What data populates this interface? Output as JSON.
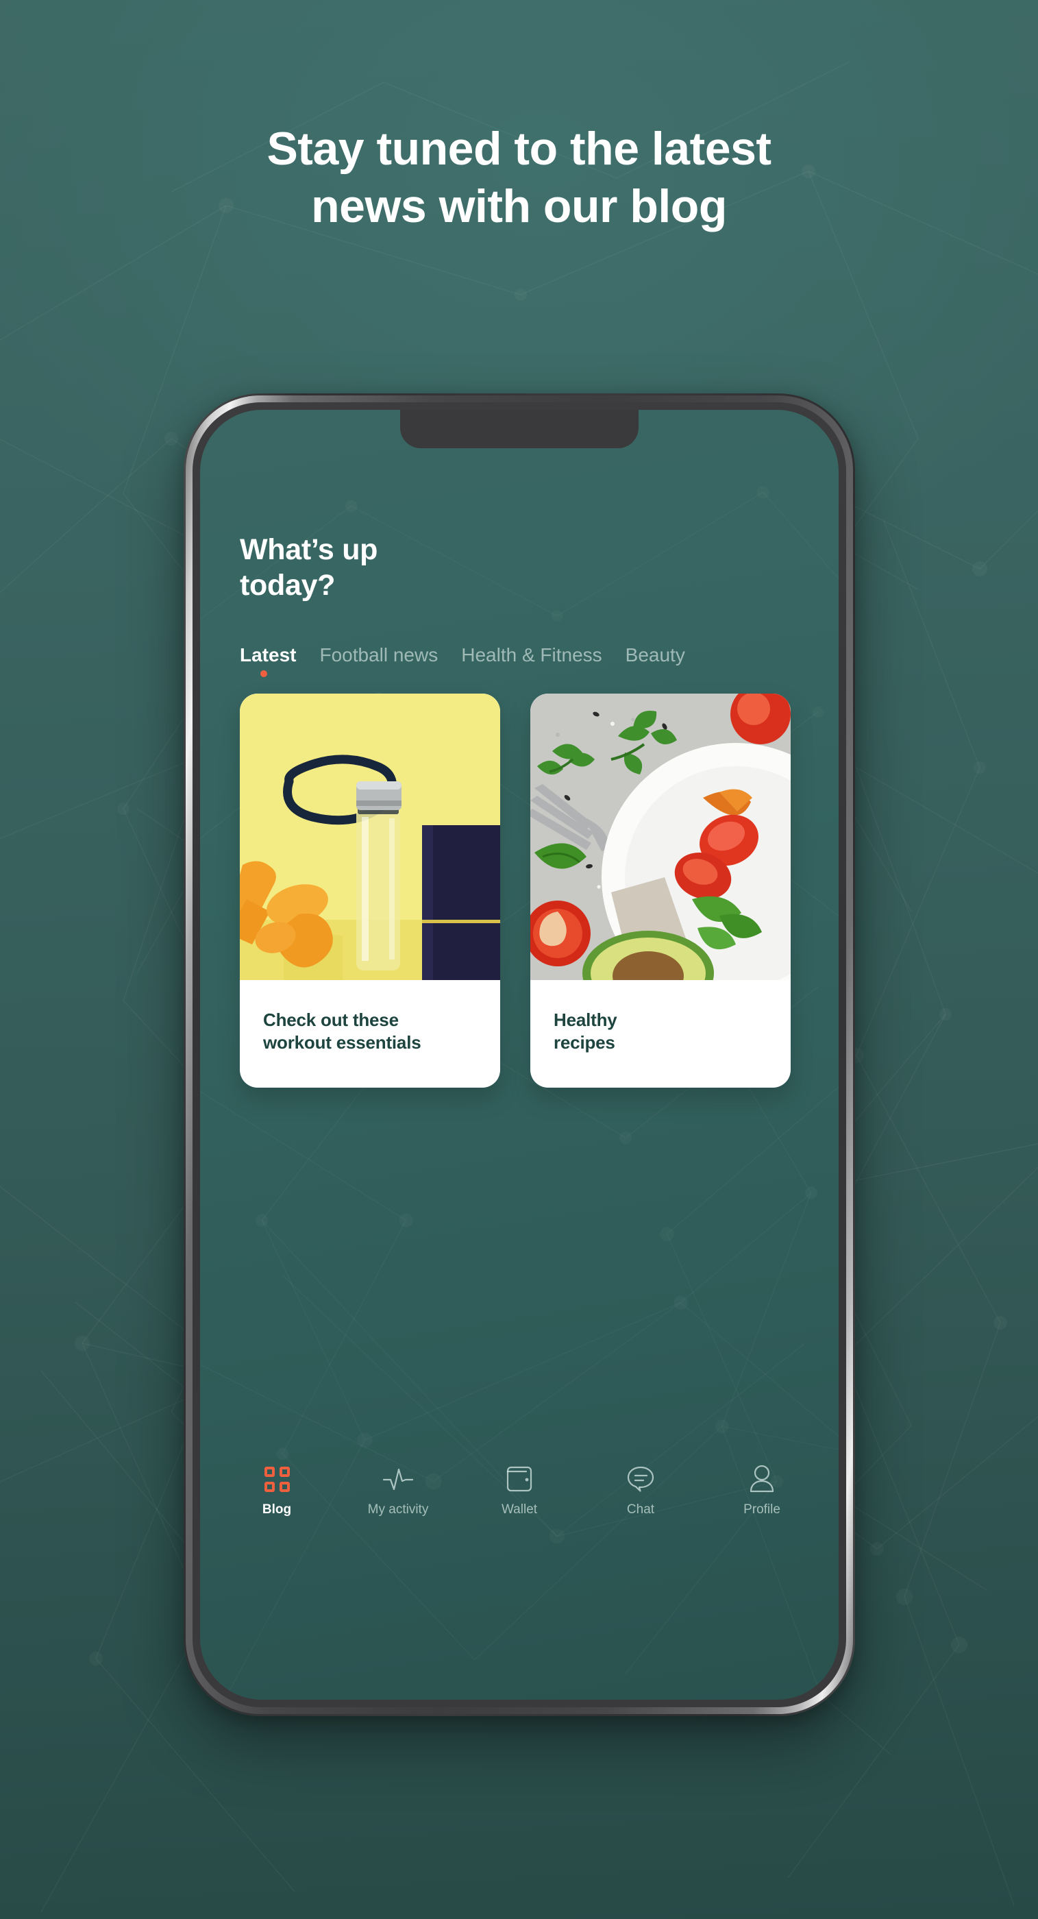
{
  "colors": {
    "bg_top": "#3e6965",
    "bg_bottom": "#284a47",
    "screen_bg": "#356460",
    "accent_orange": "#f0603f",
    "card_title": "#1d443f",
    "white": "#ffffff",
    "frame_dark": "#3a3a3c",
    "frame_silver": "#efefef"
  },
  "headline": {
    "text": "Stay tuned to the latest\nnews with our blog"
  },
  "phone": {
    "notch_label": "notch",
    "app": {
      "title": "What’s up\ntoday?",
      "tabs": [
        {
          "label": "Latest",
          "active": true
        },
        {
          "label": "Football news",
          "active": false
        },
        {
          "label": "Health & Fitness",
          "active": false
        },
        {
          "label": "Beauty",
          "active": false
        }
      ],
      "cards": [
        {
          "title": "Check out these\nworkout essentials",
          "image_alt": "water-bottle-dumbbells-towel-on-yellow-background",
          "image_bg": "#f2e97e"
        },
        {
          "title": "Healthy\nrecipes",
          "image_alt": "salad-plate-with-tomatoes-spinach-avocado-on-grey-stone",
          "image_bg": "#c9c9c6"
        }
      ],
      "nav": [
        {
          "label": "Blog",
          "icon": "grid-icon",
          "active": true
        },
        {
          "label": "My activity",
          "icon": "pulse-icon",
          "active": false
        },
        {
          "label": "Wallet",
          "icon": "wallet-icon",
          "active": false
        },
        {
          "label": "Chat",
          "icon": "chat-icon",
          "active": false
        },
        {
          "label": "Profile",
          "icon": "profile-icon",
          "active": false
        }
      ]
    }
  }
}
